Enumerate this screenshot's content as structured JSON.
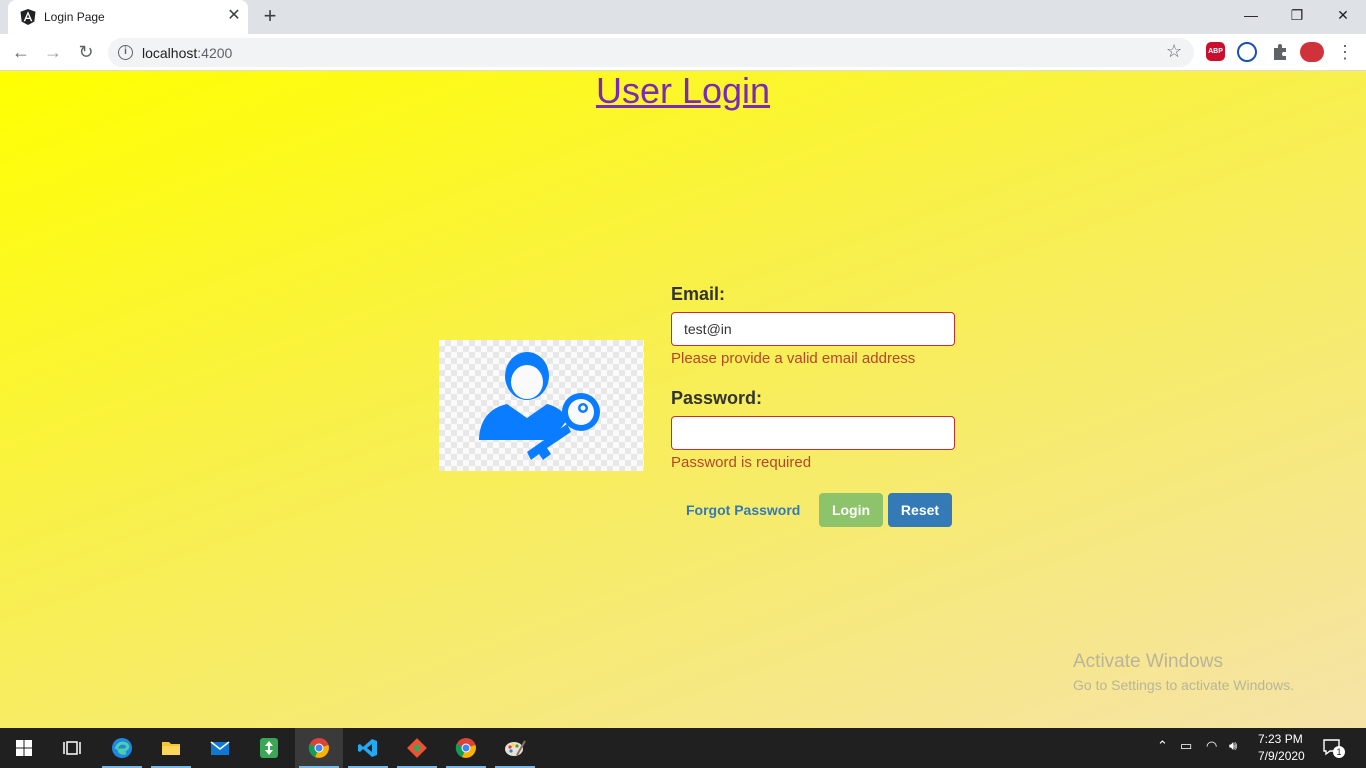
{
  "browser": {
    "tab_title": "Login Page",
    "tab_close": "✕",
    "new_tab": "+",
    "url_host": "localhost",
    "url_port": ":4200",
    "window_controls": {
      "minimize": "—",
      "restore": "❐",
      "close": "✕"
    },
    "extensions": [
      "abp-icon",
      "extension-blue-icon",
      "puzzle-icon",
      "profile-avatar-icon"
    ],
    "ext_abp_label": "ABP"
  },
  "page": {
    "title": "User Login",
    "email_label": "Email:",
    "email_value": "test@in",
    "email_error": "Please provide a valid email address",
    "password_label": "Password:",
    "password_value": "",
    "password_error": "Password is required",
    "forgot_link": "Forgot Password",
    "login_button": "Login",
    "reset_button": "Reset"
  },
  "watermark": {
    "line1": "Activate Windows",
    "line2": "Go to Settings to activate Windows."
  },
  "taskbar": {
    "apps": [
      "windows-start",
      "task-view",
      "edge",
      "file-explorer",
      "mail",
      "app-green",
      "chrome",
      "vscode",
      "git",
      "chrome",
      "paint"
    ],
    "time": "7:23 PM",
    "date": "7/9/2020",
    "notification_count": "1"
  },
  "colors": {
    "title_link": "#7b2ab7",
    "error": "#b5462b",
    "login_button": "#8cc36b",
    "reset_button": "#337ab7",
    "link": "#337ab7",
    "icon_blue": "#0a7cff"
  }
}
